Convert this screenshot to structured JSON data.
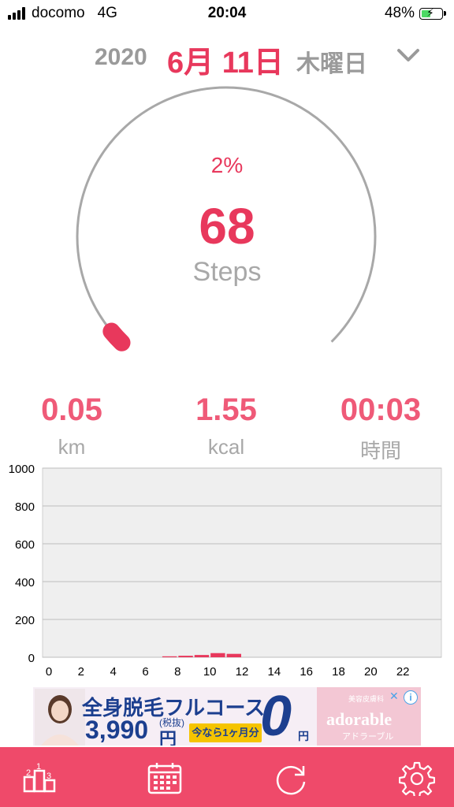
{
  "status_bar": {
    "carrier": "docomo",
    "network": "4G",
    "time": "20:04",
    "battery_percent": "48%",
    "battery_level": 0.48
  },
  "date": {
    "year": "2020",
    "month_day": "6月 11日",
    "weekday": "木曜日"
  },
  "progress": {
    "percent_label": "2%",
    "fraction": 0.02,
    "steps": "68",
    "steps_label": "Steps"
  },
  "stats": [
    {
      "value": "0.05",
      "label": "km"
    },
    {
      "value": "1.55",
      "label": "kcal"
    },
    {
      "value": "00:03",
      "label": "時間"
    }
  ],
  "chart_data": {
    "type": "bar",
    "title": "",
    "xlabel": "",
    "ylabel": "",
    "ylim": [
      0,
      1000
    ],
    "xlim": [
      0,
      24
    ],
    "y_ticks": [
      0,
      200,
      400,
      600,
      800,
      1000
    ],
    "x_ticks": [
      0,
      2,
      4,
      6,
      8,
      10,
      12,
      14,
      16,
      18,
      20,
      22
    ],
    "grid": true,
    "bar_color": "#e8385c",
    "categories": [
      0,
      1,
      2,
      3,
      4,
      5,
      6,
      7,
      8,
      9,
      10,
      11,
      12,
      13,
      14,
      15,
      16,
      17,
      18,
      19,
      20,
      21,
      22,
      23
    ],
    "values": [
      0,
      0,
      0,
      0,
      0,
      0,
      0,
      5,
      8,
      12,
      22,
      18,
      0,
      0,
      0,
      0,
      0,
      0,
      0,
      0,
      0,
      0,
      0,
      0
    ]
  },
  "ad": {
    "headline": "全身脱毛フルコース",
    "price": "3,990",
    "tax_note": "(税抜)",
    "yen": "円",
    "cta": "今なら1ヶ月分",
    "zero": "0",
    "zero_yen": "円",
    "brand": "adorable",
    "brand_top": "美容皮膚科",
    "brand_sub": "アドラーブル"
  },
  "colors": {
    "accent": "#e8385c",
    "stat": "#ef5a78",
    "label_gray": "#a8a8a8",
    "tab_bar": "#ef4a6a"
  },
  "tab_bar": {
    "icons": [
      "ranking-icon",
      "calendar-icon",
      "refresh-icon",
      "gear-icon"
    ]
  }
}
